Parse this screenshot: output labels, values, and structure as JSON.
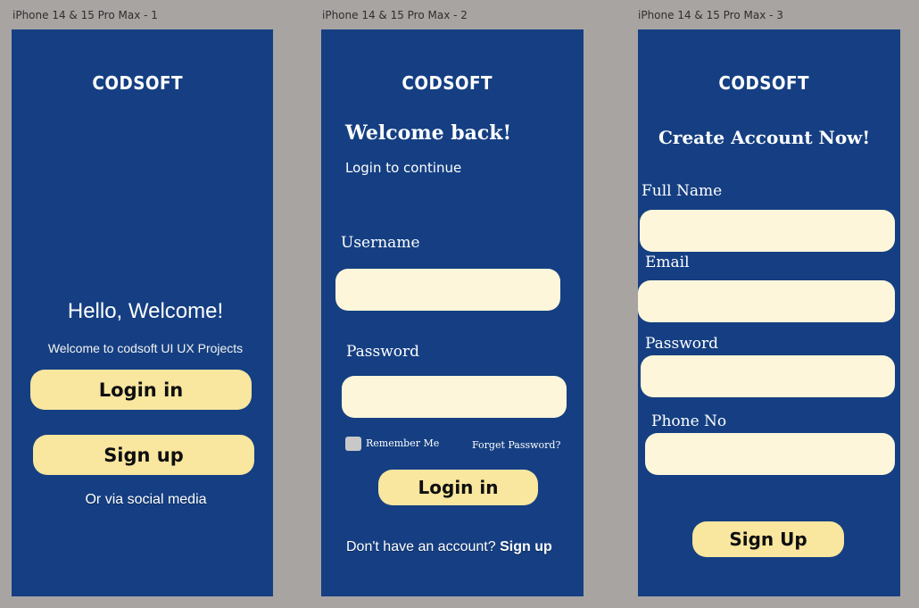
{
  "frames": [
    {
      "label": "iPhone 14 & 15 Pro Max - 1"
    },
    {
      "label": "iPhone 14 & 15 Pro Max - 2"
    },
    {
      "label": "iPhone 14 & 15 Pro Max - 3"
    }
  ],
  "brand": "CODSOFT",
  "screen1": {
    "heading": "Hello, Welcome!",
    "subtitle": "Welcome to codsoft UI UX Projects",
    "login_button": "Login in",
    "signup_button": "Sign up",
    "social_text": "Or via social media"
  },
  "screen2": {
    "heading": "Welcome back!",
    "subheading": "Login to continue",
    "username_label": "Username",
    "password_label": "Password",
    "remember_label": "Remember Me",
    "forgot_link": "Forget Password?",
    "login_button": "Login in",
    "no_account_text": "Don't have an account?",
    "signup_link": "Sign up"
  },
  "screen3": {
    "heading": "Create Account Now!",
    "fullname_label": "Full Name",
    "email_label": "Email",
    "password_label": "Password",
    "phone_label": "Phone No",
    "signup_button": "Sign Up"
  },
  "colors": {
    "canvas": "#a8a4a2",
    "phone_bg": "#153f82",
    "button_yellow": "#f9e69f",
    "field_cream": "#fdf6da"
  }
}
